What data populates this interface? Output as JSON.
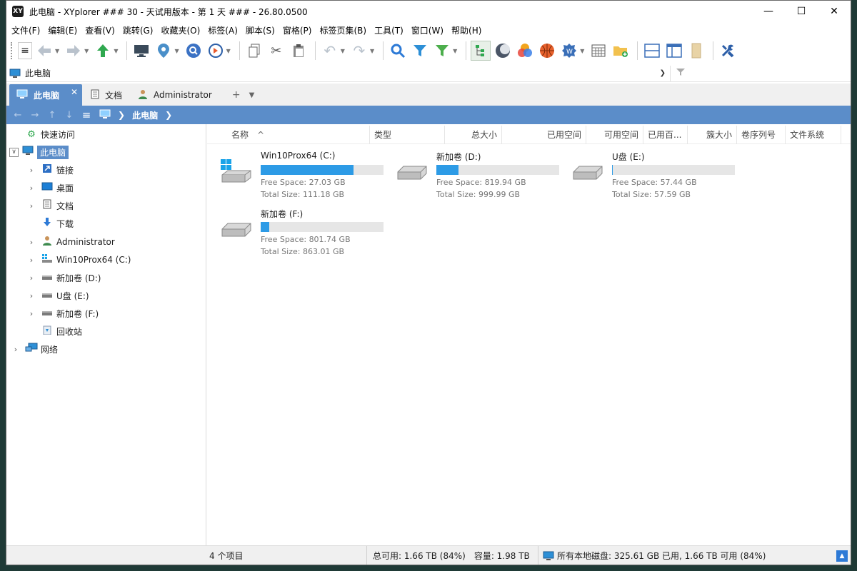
{
  "window": {
    "title": "此电脑 - XYplorer ### 30 - 天试用版本 - 第 1 天 ### - 26.80.0500",
    "logo_text": "XY",
    "controls": {
      "minimize": "—",
      "maximize": "☐",
      "close": "✕"
    }
  },
  "menu": [
    "文件(F)",
    "编辑(E)",
    "查看(V)",
    "跳转(G)",
    "收藏夹(O)",
    "标签(A)",
    "脚本(S)",
    "窗格(P)",
    "标签页集(B)",
    "工具(T)",
    "窗口(W)",
    "帮助(H)"
  ],
  "address": {
    "value": "此电脑"
  },
  "tabs": [
    {
      "label": "此电脑",
      "active": true
    },
    {
      "label": "文档",
      "active": false
    },
    {
      "label": "Administrator",
      "active": false
    }
  ],
  "tab_controls": {
    "add": "+",
    "menu": "▼",
    "close": "✕"
  },
  "breadcrumb": {
    "current": "此电脑"
  },
  "tree": {
    "quick_access": "快速访问",
    "this_pc": "此电脑",
    "links": "链接",
    "desktop": "桌面",
    "documents": "文档",
    "downloads": "下载",
    "administrator": "Administrator",
    "drive_c": "Win10Prox64 (C:)",
    "drive_d": "新加卷 (D:)",
    "drive_e": "U盘 (E:)",
    "drive_f": "新加卷 (F:)",
    "recycle": "回收站",
    "network": "网络"
  },
  "columns": {
    "name": "名称",
    "type": "类型",
    "total": "总大小",
    "used": "已用空间",
    "free": "可用空间",
    "used_pct": "已用百...",
    "cluster": "簇大小",
    "serial": "卷序列号",
    "fs": "文件系统"
  },
  "sort_indicator": "^",
  "drives": [
    {
      "name": "Win10Prox64 (C:)",
      "free": "Free Space: 27.03 GB",
      "total": "Total Size: 111.18 GB",
      "used_fraction": 0.757
    },
    {
      "name": "新加卷 (D:)",
      "free": "Free Space: 819.94 GB",
      "total": "Total Size: 999.99 GB",
      "used_fraction": 0.18
    },
    {
      "name": "U盘 (E:)",
      "free": "Free Space: 57.44 GB",
      "total": "Total Size: 57.59 GB",
      "used_fraction": 0.003
    },
    {
      "name": "新加卷 (F:)",
      "free": "Free Space: 801.74 GB",
      "total": "Total Size: 863.01 GB",
      "used_fraction": 0.071
    }
  ],
  "status": {
    "count": "4 个项目",
    "total_free": "总可用: 1.66 TB (84%)",
    "capacity": "容量: 1.98 TB",
    "all_disks": "所有本地磁盘: 325.61 GB 已用, 1.66 TB 可用 (84%)"
  },
  "colors": {
    "accent": "#5b8dc9",
    "bar_fill": "#2d9be6",
    "bar_bg": "#e6e6e6"
  }
}
